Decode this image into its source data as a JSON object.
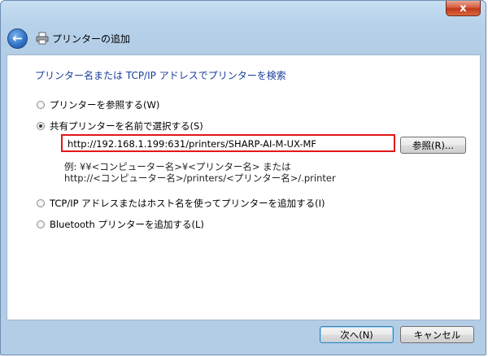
{
  "window": {
    "close_label": "x"
  },
  "nav": {
    "title": "プリンターの追加",
    "back_icon": "back-arrow-icon",
    "printer_icon": "printer-icon"
  },
  "main": {
    "heading": "プリンター名または TCP/IP アドレスでプリンターを検索",
    "options": [
      {
        "label": "プリンターを参照する(W)",
        "checked": false
      },
      {
        "label": "共有プリンターを名前で選択する(S)",
        "checked": true
      },
      {
        "label": "TCP/IP アドレスまたはホスト名を使ってプリンターを追加する(I)",
        "checked": false
      },
      {
        "label": "Bluetooth プリンターを追加する(L)",
        "checked": false
      }
    ],
    "url_value": "http://192.168.1.199:631/printers/SHARP-AI-M-UX-MF",
    "browse_label": "参照(R)...",
    "example_line1": "例: ¥¥<コンピューター名>¥<プリンター名> または",
    "example_line2": "http://<コンピューター名>/printers/<プリンター名>/.printer"
  },
  "footer": {
    "next_label": "次へ(N)",
    "cancel_label": "キャンセル"
  },
  "colors": {
    "heading": "#1a3e9c",
    "highlight_border": "#e01818",
    "window_frame": "#b4cde6"
  }
}
